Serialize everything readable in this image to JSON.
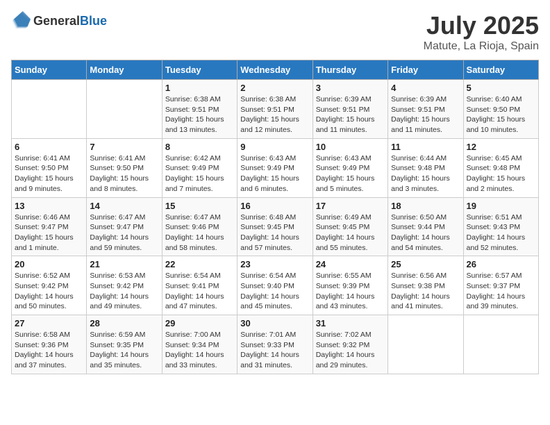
{
  "header": {
    "logo_general": "General",
    "logo_blue": "Blue",
    "month": "July 2025",
    "location": "Matute, La Rioja, Spain"
  },
  "weekdays": [
    "Sunday",
    "Monday",
    "Tuesday",
    "Wednesday",
    "Thursday",
    "Friday",
    "Saturday"
  ],
  "weeks": [
    [
      {
        "day": "",
        "info": ""
      },
      {
        "day": "",
        "info": ""
      },
      {
        "day": "1",
        "info": "Sunrise: 6:38 AM\nSunset: 9:51 PM\nDaylight: 15 hours and 13 minutes."
      },
      {
        "day": "2",
        "info": "Sunrise: 6:38 AM\nSunset: 9:51 PM\nDaylight: 15 hours and 12 minutes."
      },
      {
        "day": "3",
        "info": "Sunrise: 6:39 AM\nSunset: 9:51 PM\nDaylight: 15 hours and 11 minutes."
      },
      {
        "day": "4",
        "info": "Sunrise: 6:39 AM\nSunset: 9:51 PM\nDaylight: 15 hours and 11 minutes."
      },
      {
        "day": "5",
        "info": "Sunrise: 6:40 AM\nSunset: 9:50 PM\nDaylight: 15 hours and 10 minutes."
      }
    ],
    [
      {
        "day": "6",
        "info": "Sunrise: 6:41 AM\nSunset: 9:50 PM\nDaylight: 15 hours and 9 minutes."
      },
      {
        "day": "7",
        "info": "Sunrise: 6:41 AM\nSunset: 9:50 PM\nDaylight: 15 hours and 8 minutes."
      },
      {
        "day": "8",
        "info": "Sunrise: 6:42 AM\nSunset: 9:49 PM\nDaylight: 15 hours and 7 minutes."
      },
      {
        "day": "9",
        "info": "Sunrise: 6:43 AM\nSunset: 9:49 PM\nDaylight: 15 hours and 6 minutes."
      },
      {
        "day": "10",
        "info": "Sunrise: 6:43 AM\nSunset: 9:49 PM\nDaylight: 15 hours and 5 minutes."
      },
      {
        "day": "11",
        "info": "Sunrise: 6:44 AM\nSunset: 9:48 PM\nDaylight: 15 hours and 3 minutes."
      },
      {
        "day": "12",
        "info": "Sunrise: 6:45 AM\nSunset: 9:48 PM\nDaylight: 15 hours and 2 minutes."
      }
    ],
    [
      {
        "day": "13",
        "info": "Sunrise: 6:46 AM\nSunset: 9:47 PM\nDaylight: 15 hours and 1 minute."
      },
      {
        "day": "14",
        "info": "Sunrise: 6:47 AM\nSunset: 9:47 PM\nDaylight: 14 hours and 59 minutes."
      },
      {
        "day": "15",
        "info": "Sunrise: 6:47 AM\nSunset: 9:46 PM\nDaylight: 14 hours and 58 minutes."
      },
      {
        "day": "16",
        "info": "Sunrise: 6:48 AM\nSunset: 9:45 PM\nDaylight: 14 hours and 57 minutes."
      },
      {
        "day": "17",
        "info": "Sunrise: 6:49 AM\nSunset: 9:45 PM\nDaylight: 14 hours and 55 minutes."
      },
      {
        "day": "18",
        "info": "Sunrise: 6:50 AM\nSunset: 9:44 PM\nDaylight: 14 hours and 54 minutes."
      },
      {
        "day": "19",
        "info": "Sunrise: 6:51 AM\nSunset: 9:43 PM\nDaylight: 14 hours and 52 minutes."
      }
    ],
    [
      {
        "day": "20",
        "info": "Sunrise: 6:52 AM\nSunset: 9:42 PM\nDaylight: 14 hours and 50 minutes."
      },
      {
        "day": "21",
        "info": "Sunrise: 6:53 AM\nSunset: 9:42 PM\nDaylight: 14 hours and 49 minutes."
      },
      {
        "day": "22",
        "info": "Sunrise: 6:54 AM\nSunset: 9:41 PM\nDaylight: 14 hours and 47 minutes."
      },
      {
        "day": "23",
        "info": "Sunrise: 6:54 AM\nSunset: 9:40 PM\nDaylight: 14 hours and 45 minutes."
      },
      {
        "day": "24",
        "info": "Sunrise: 6:55 AM\nSunset: 9:39 PM\nDaylight: 14 hours and 43 minutes."
      },
      {
        "day": "25",
        "info": "Sunrise: 6:56 AM\nSunset: 9:38 PM\nDaylight: 14 hours and 41 minutes."
      },
      {
        "day": "26",
        "info": "Sunrise: 6:57 AM\nSunset: 9:37 PM\nDaylight: 14 hours and 39 minutes."
      }
    ],
    [
      {
        "day": "27",
        "info": "Sunrise: 6:58 AM\nSunset: 9:36 PM\nDaylight: 14 hours and 37 minutes."
      },
      {
        "day": "28",
        "info": "Sunrise: 6:59 AM\nSunset: 9:35 PM\nDaylight: 14 hours and 35 minutes."
      },
      {
        "day": "29",
        "info": "Sunrise: 7:00 AM\nSunset: 9:34 PM\nDaylight: 14 hours and 33 minutes."
      },
      {
        "day": "30",
        "info": "Sunrise: 7:01 AM\nSunset: 9:33 PM\nDaylight: 14 hours and 31 minutes."
      },
      {
        "day": "31",
        "info": "Sunrise: 7:02 AM\nSunset: 9:32 PM\nDaylight: 14 hours and 29 minutes."
      },
      {
        "day": "",
        "info": ""
      },
      {
        "day": "",
        "info": ""
      }
    ]
  ]
}
